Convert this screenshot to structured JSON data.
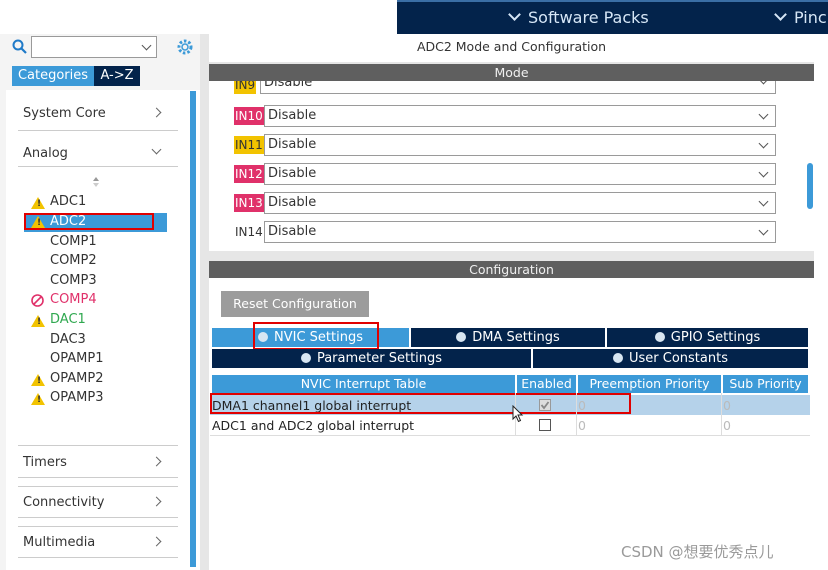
{
  "topbar": {
    "software_packs": "Software Packs",
    "pinout_partial": "Pinc"
  },
  "sidebar": {
    "tabs": [
      "Categories",
      "A->Z"
    ],
    "categories": [
      {
        "label": "System Core",
        "expanded": false
      },
      {
        "label": "Analog",
        "expanded": true
      },
      {
        "label": "Timers",
        "expanded": false
      },
      {
        "label": "Connectivity",
        "expanded": false
      },
      {
        "label": "Multimedia",
        "expanded": false
      }
    ],
    "analog_items": [
      {
        "label": "ADC1",
        "status": "warning",
        "color": "#333333"
      },
      {
        "label": "ADC2",
        "status": "warning",
        "color": "#ffffff",
        "selected": true
      },
      {
        "label": "COMP1",
        "status": "none",
        "color": "#333333"
      },
      {
        "label": "COMP2",
        "status": "none",
        "color": "#333333"
      },
      {
        "label": "COMP3",
        "status": "none",
        "color": "#333333"
      },
      {
        "label": "COMP4",
        "status": "disabled",
        "color": "#e0316a"
      },
      {
        "label": "DAC1",
        "status": "warning",
        "color": "#2fa84f"
      },
      {
        "label": "DAC3",
        "status": "none",
        "color": "#333333"
      },
      {
        "label": "OPAMP1",
        "status": "none",
        "color": "#333333"
      },
      {
        "label": "OPAMP2",
        "status": "warning",
        "color": "#333333"
      },
      {
        "label": "OPAMP3",
        "status": "warning",
        "color": "#333333"
      }
    ]
  },
  "main": {
    "title": "ADC2 Mode and Configuration",
    "mode_header": "Mode",
    "mode_rows": [
      {
        "pin": "IN9",
        "value": "Disable",
        "pin_bg": "#f2c300",
        "pin_color": "#333333"
      },
      {
        "pin": "IN10",
        "value": "Disable",
        "pin_bg": "#e0316a",
        "pin_color": "#ffffff"
      },
      {
        "pin": "IN11",
        "value": "Disable",
        "pin_bg": "#f2c300",
        "pin_color": "#333333"
      },
      {
        "pin": "IN12",
        "value": "Disable",
        "pin_bg": "#e0316a",
        "pin_color": "#ffffff"
      },
      {
        "pin": "IN13",
        "value": "Disable",
        "pin_bg": "#e0316a",
        "pin_color": "#ffffff"
      },
      {
        "pin": "IN14",
        "value": "Disable",
        "pin_bg": "transparent",
        "pin_color": "#333333"
      }
    ],
    "config_header": "Configuration",
    "reset_button": "Reset Configuration",
    "tabs_row1": [
      "NVIC Settings",
      "DMA Settings",
      "GPIO Settings"
    ],
    "tabs_row2": [
      "Parameter Settings",
      "User Constants"
    ],
    "table": {
      "headers": [
        "NVIC Interrupt Table",
        "Enabled",
        "Preemption Priority",
        "Sub Priority"
      ],
      "rows": [
        {
          "name": "DMA1 channel1 global interrupt",
          "enabled": true,
          "preemption": "0",
          "sub": "0"
        },
        {
          "name": "ADC1 and ADC2 global interrupt",
          "enabled": false,
          "preemption": "0",
          "sub": "0"
        }
      ]
    }
  },
  "watermark": "CSDN @想要优秀点儿"
}
